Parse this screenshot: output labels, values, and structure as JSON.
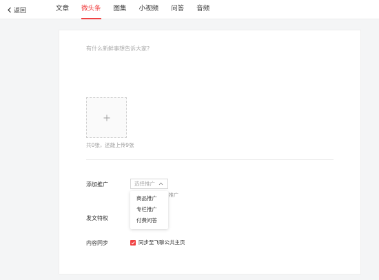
{
  "header": {
    "back_label": "返回",
    "tabs": [
      {
        "label": "文章",
        "active": false
      },
      {
        "label": "微头条",
        "active": true
      },
      {
        "label": "图集",
        "active": false
      },
      {
        "label": "小视频",
        "active": false
      },
      {
        "label": "问答",
        "active": false
      },
      {
        "label": "音频",
        "active": false
      }
    ]
  },
  "editor": {
    "placeholder": "有什么新鲜事想告诉大家?"
  },
  "upload": {
    "hint": "共0张，还能上传9张"
  },
  "form": {
    "promotion_label": "添加推广",
    "promotion_select": "选择推广",
    "promotion_tail": "推广",
    "promotion_options": [
      "商品推广",
      "专栏推广",
      "付费问答"
    ],
    "rights_label": "发文特权",
    "sync_label": "内容同步",
    "sync_option": "同步至飞聊公共主页",
    "sync_checked": true
  },
  "colors": {
    "accent": "#f04142"
  }
}
